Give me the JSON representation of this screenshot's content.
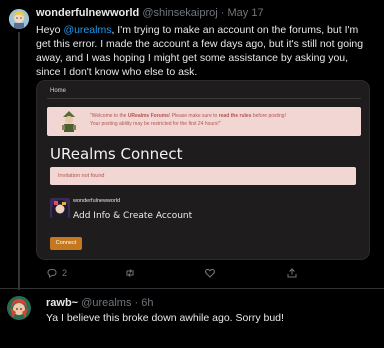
{
  "tweet1": {
    "author_name": "wonderfulnewworld",
    "author_handle": "@shinsekaiproj",
    "separator": "·",
    "date": "May 17",
    "text_before_mention": "Heyo ",
    "mention": "@urealms",
    "text_after_mention": ", I'm trying to make an account on the forums, but I'm get this error. I made the account a few days ago, but it's still not going away, and I was hoping I might get some assistance by asking you, since I don't know who else to ask.",
    "actions": {
      "reply_count": "2",
      "retweet_count": "",
      "like_count": ""
    }
  },
  "embed": {
    "nav_home": "Home",
    "welcome_prefix": "\"Welcome to the ",
    "welcome_forums": "URealms Forums",
    "welcome_middle": "! Please make sure to ",
    "welcome_rules": "read the rules",
    "welcome_suffix": " before posting!",
    "welcome_line2": "Your posting ability may be restricted for the first 24 hours!\"",
    "title": "URealms Connect",
    "error": "Invitation not found",
    "username": "wonderfulnewworld",
    "add_info": "Add Info & Create Account",
    "connect_button": "Connect",
    "colors": {
      "panel_bg": "#1e1c1d",
      "alert_bg": "#f2d6d4",
      "alert_text": "#b0554d",
      "button_bg": "#c5791f"
    }
  },
  "tweet2": {
    "author_name": "rawb~",
    "author_handle": "@urealms",
    "separator": "·",
    "date": "6h",
    "text": "Ya I believe this broke down awhile ago. Sorry bud!"
  },
  "colors": {
    "background": "#000000",
    "primary_text": "#e7e9ea",
    "secondary_text": "#71767b",
    "link": "#1d9bf0",
    "divider": "#2f3336"
  },
  "icons": [
    "reply-icon",
    "retweet-icon",
    "like-icon",
    "share-icon"
  ]
}
